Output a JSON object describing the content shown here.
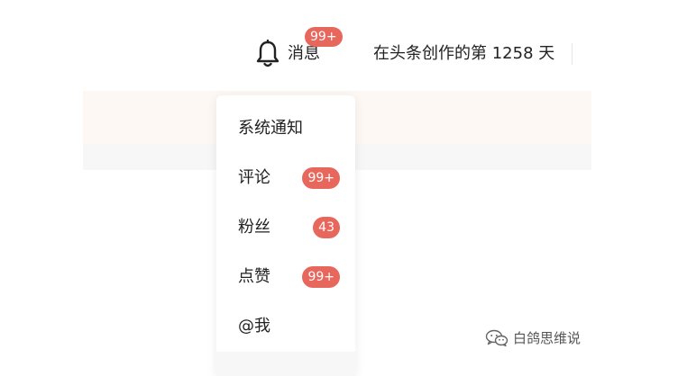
{
  "header": {
    "notifications": {
      "icon": "bell-icon",
      "label": "消息",
      "badge": "99+"
    },
    "creator_days": "在头条创作的第 1258 天"
  },
  "dropdown": {
    "items": [
      {
        "label": "系统通知",
        "badge": ""
      },
      {
        "label": "评论",
        "badge": "99+"
      },
      {
        "label": "粉丝",
        "badge": "43"
      },
      {
        "label": "点赞",
        "badge": "99+"
      },
      {
        "label": "@我",
        "badge": ""
      }
    ]
  },
  "watermark": {
    "icon": "wechat-icon",
    "text": "白鸽思维说"
  },
  "colors": {
    "badge": "#e8675d",
    "text": "#222222",
    "cream_band": "#fdf8f3",
    "grey_band": "#f7f7f7"
  }
}
